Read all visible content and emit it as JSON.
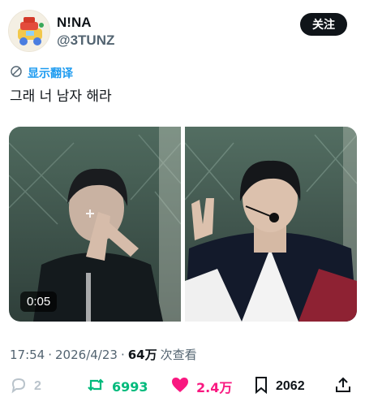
{
  "header": {
    "display_name": "N!NA",
    "handle": "@3TUNZ",
    "follow_label": "关注"
  },
  "translate": {
    "label": "显示翻译",
    "icon": "translate-icon"
  },
  "tweet": {
    "text": "그래 너 남자 해라"
  },
  "media": {
    "video_duration": "0:05"
  },
  "meta": {
    "time": "17:54",
    "date": "2026/4/23",
    "views": "64万",
    "views_suffix": "次查看"
  },
  "actions": {
    "replies": "2",
    "retweets": "6993",
    "likes": "2.4万",
    "bookmarks": "2062"
  },
  "colors": {
    "like": "#f91880",
    "retweet": "#00ba7c",
    "link": "#1d9bf0",
    "muted": "#536471"
  }
}
